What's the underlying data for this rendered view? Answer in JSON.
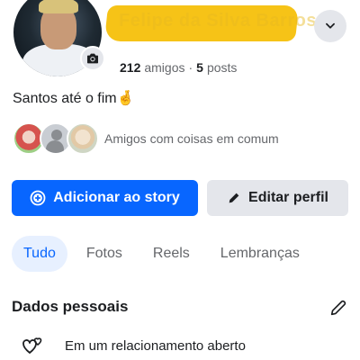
{
  "profile": {
    "name": "Felipe da Silva Barros",
    "friends_count": "212",
    "friends_word": "amigos",
    "separator": "·",
    "posts_count": "5",
    "posts_word": "posts",
    "bio": "Santos até o fim🤞"
  },
  "mutual": {
    "label": "Amigos com coisas em comum"
  },
  "actions": {
    "add_story": "Adicionar ao story",
    "edit_profile": "Editar perfil"
  },
  "tabs": [
    {
      "label": "Tudo",
      "active": true
    },
    {
      "label": "Fotos",
      "active": false
    },
    {
      "label": "Reels",
      "active": false
    },
    {
      "label": "Lembranças",
      "active": false
    }
  ],
  "personal": {
    "title": "Dados pessoais",
    "relationship": "Em um relacionamento aberto"
  },
  "colors": {
    "accent": "#0866ff",
    "secondary_button": "#e4e6eb",
    "redaction": "#f6c317"
  },
  "icons": [
    "camera-icon",
    "chevron-down-icon",
    "add-story-icon",
    "pencil-icon",
    "hearts-icon"
  ]
}
